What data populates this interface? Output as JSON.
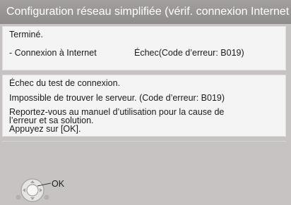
{
  "screen_title": "Configuration réseau simplifiée (vérif. connexion Internet",
  "result_panel": {
    "status": "Terminé.",
    "item_label": "- Connexion à Internet",
    "item_value": "Échec(Code d’erreur: B019)"
  },
  "message_panel": {
    "line1": "Échec du test de connexion.",
    "line2": "Impossible de trouver le serveur. (Code d’erreur: B019)",
    "para_line1": "Reportez-vous au manuel d’utilisation pour la cause de",
    "para_line2": "l’erreur et sa solution.",
    "para_line3": "Appuyez sur [OK]."
  },
  "nav_hint": {
    "icon": "remote-dpad-icon",
    "label": "OK"
  }
}
